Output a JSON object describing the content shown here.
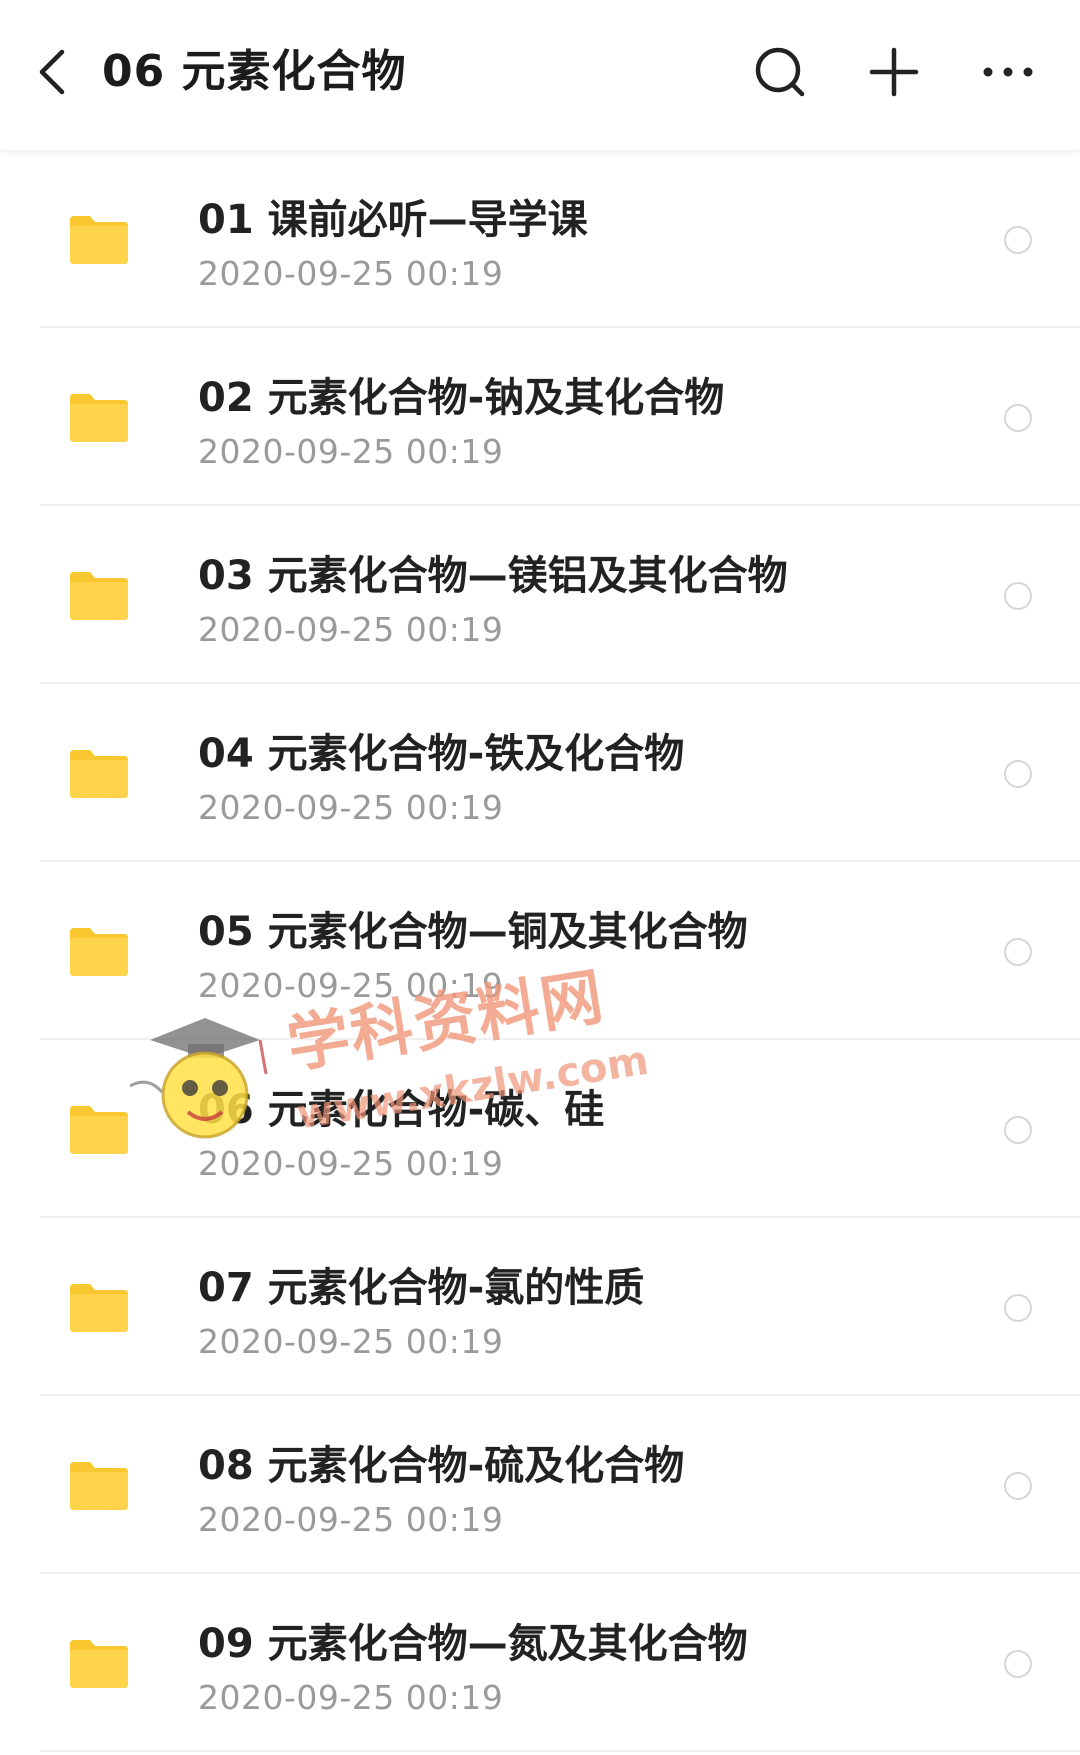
{
  "header": {
    "title": "06 元素化合物",
    "back_icon": "chevron-left-icon",
    "search_icon": "search-icon",
    "add_icon": "plus-icon",
    "more_icon": "more-horizontal-icon"
  },
  "colors": {
    "folder": "#FFD44A",
    "folder_tab": "#F9C831",
    "title_text": "#1C1C1C",
    "date_text": "#9A9A9A",
    "divider": "#F0F0F0"
  },
  "items": [
    {
      "name": "01 课前必听—导学课",
      "date": "2020-09-25  00:19",
      "icon": "folder-icon"
    },
    {
      "name": "02 元素化合物-钠及其化合物",
      "date": "2020-09-25  00:19",
      "icon": "folder-icon"
    },
    {
      "name": "03 元素化合物—镁铝及其化合物",
      "date": "2020-09-25  00:19",
      "icon": "folder-icon"
    },
    {
      "name": "04 元素化合物-铁及化合物",
      "date": "2020-09-25  00:19",
      "icon": "folder-icon"
    },
    {
      "name": "05 元素化合物—铜及其化合物",
      "date": "2020-09-25  00:19",
      "icon": "folder-icon"
    },
    {
      "name": "06 元素化合物-碳、硅",
      "date": "2020-09-25  00:19",
      "icon": "folder-icon"
    },
    {
      "name": "07 元素化合物-氯的性质",
      "date": "2020-09-25  00:19",
      "icon": "folder-icon"
    },
    {
      "name": "08 元素化合物-硫及化合物",
      "date": "2020-09-25  00:19",
      "icon": "folder-icon"
    },
    {
      "name": "09 元素化合物—氮及其化合物",
      "date": "2020-09-25  00:19",
      "icon": "folder-icon"
    }
  ],
  "watermark": {
    "text": "学科资料网",
    "url": "www.xkzlw.com"
  }
}
